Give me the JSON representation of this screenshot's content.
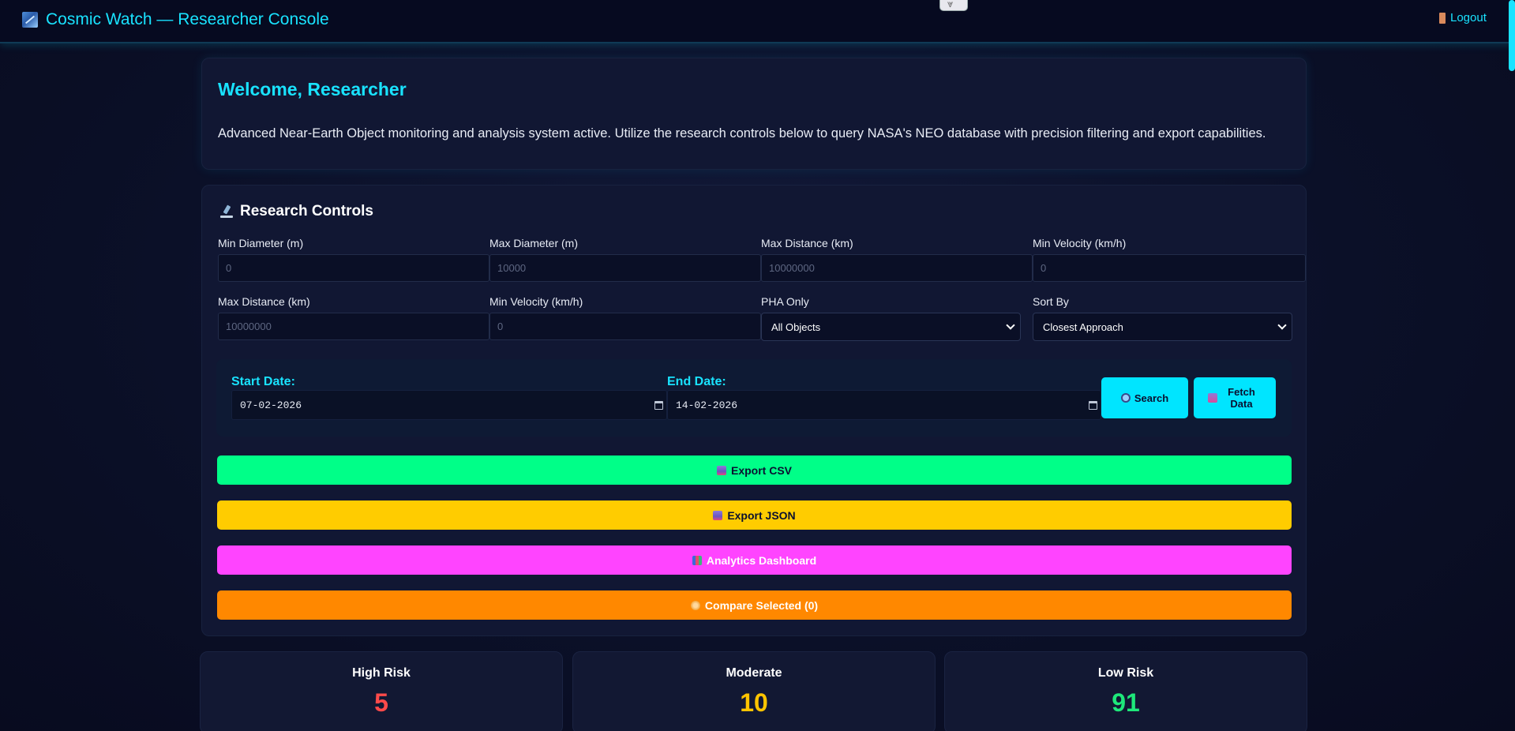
{
  "header": {
    "title": "Cosmic Watch — Researcher Console",
    "logout_label": "Logout"
  },
  "welcome": {
    "title": "Welcome, Researcher",
    "text": "Advanced Near-Earth Object monitoring and analysis system active. Utilize the research controls below to query NASA's NEO database with precision filtering and export capabilities."
  },
  "controls": {
    "title": "Research Controls",
    "row1": [
      {
        "label": "Min Diameter (m)",
        "placeholder": "0"
      },
      {
        "label": "Max Diameter (m)",
        "placeholder": "10000"
      },
      {
        "label": "Max Distance (km)",
        "placeholder": "10000000"
      },
      {
        "label": "Min Velocity (km/h)",
        "placeholder": "0"
      }
    ],
    "row2": [
      {
        "label": "Max Distance (km)",
        "placeholder": "10000000"
      },
      {
        "label": "Min Velocity (km/h)",
        "placeholder": "0"
      }
    ],
    "pha": {
      "label": "PHA Only",
      "selected": "All Objects"
    },
    "sort": {
      "label": "Sort By",
      "selected": "Closest Approach"
    },
    "start_date": {
      "label": "Start Date:",
      "value": "07-02-2026"
    },
    "end_date": {
      "label": "End Date:",
      "value": "14-02-2026"
    },
    "search_label": "Search",
    "fetch_label": "Fetch Data",
    "export_csv_label": "Export CSV",
    "export_json_label": "Export JSON",
    "analytics_label": "Analytics Dashboard",
    "compare_label": "Compare Selected (0)"
  },
  "stats": [
    {
      "label": "High Risk",
      "value": "5",
      "color": "#ff4a4a"
    },
    {
      "label": "Moderate",
      "value": "10",
      "color": "#ffc400"
    },
    {
      "label": "Low Risk",
      "value": "91",
      "color": "#1ee87a"
    }
  ],
  "colors": {
    "accent": "#19e3ff",
    "csv": "#00ff88",
    "json": "#ffcc00",
    "analytics": "#ff44ff",
    "compare": "#ff8800"
  }
}
